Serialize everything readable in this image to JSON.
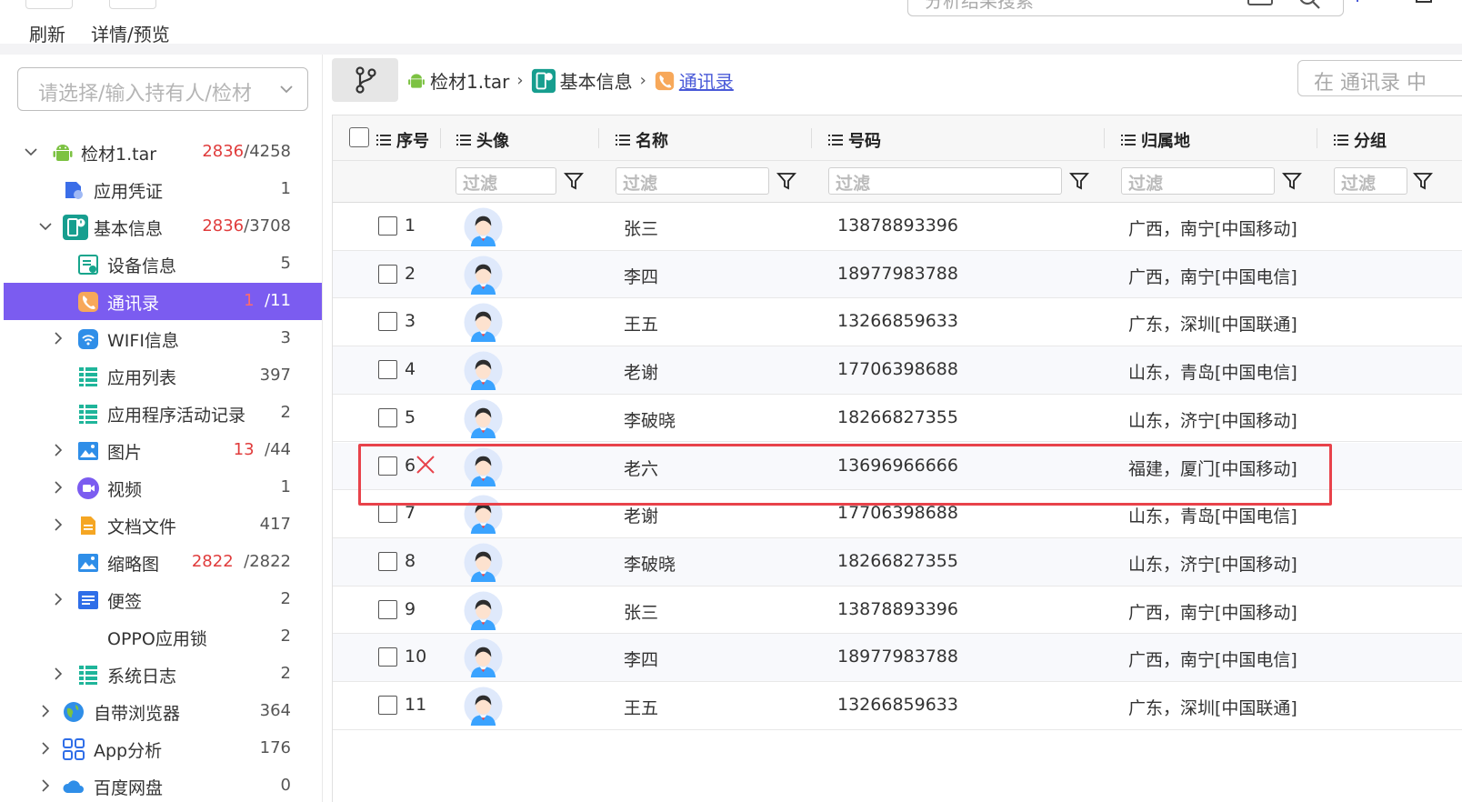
{
  "toolbar": {
    "refresh_label": "刷新",
    "detail_label": "详情/预览",
    "search_placeholder": "分析结果搜索"
  },
  "sidebar": {
    "holder_placeholder": "请选择/输入持有人/检材",
    "items": [
      {
        "label": "检材1.tar",
        "count_red": "2836",
        "count_rest": "/4258",
        "icon": "android-icon"
      },
      {
        "label": "应用凭证",
        "count_red": "",
        "count_rest": "1",
        "icon": "credential-icon"
      },
      {
        "label": "基本信息",
        "count_red": "2836",
        "count_rest": "/3708",
        "icon": "basic-info-icon"
      },
      {
        "label": "设备信息",
        "count_red": "",
        "count_rest": "5",
        "icon": "device-info-icon"
      },
      {
        "label": "通讯录",
        "count_red": "1",
        "count_rest": "/11",
        "icon": "contacts-icon"
      },
      {
        "label": "WIFI信息",
        "count_red": "",
        "count_rest": "3",
        "icon": "wifi-icon"
      },
      {
        "label": "应用列表",
        "count_red": "",
        "count_rest": "397",
        "icon": "list-icon"
      },
      {
        "label": "应用程序活动记录",
        "count_red": "",
        "count_rest": "2",
        "icon": "list-icon"
      },
      {
        "label": "图片",
        "count_red": "13",
        "count_rest": "/44",
        "icon": "image-icon"
      },
      {
        "label": "视频",
        "count_red": "",
        "count_rest": "1",
        "icon": "video-icon"
      },
      {
        "label": "文档文件",
        "count_red": "",
        "count_rest": "417",
        "icon": "document-icon"
      },
      {
        "label": "缩略图",
        "count_red": "2822",
        "count_rest": "/2822",
        "icon": "image-icon"
      },
      {
        "label": "便签",
        "count_red": "",
        "count_rest": "2",
        "icon": "note-icon"
      },
      {
        "label": "OPPO应用锁",
        "count_red": "",
        "count_rest": "2",
        "icon": ""
      },
      {
        "label": "系统日志",
        "count_red": "",
        "count_rest": "2",
        "icon": "list-icon"
      },
      {
        "label": "自带浏览器",
        "count_red": "",
        "count_rest": "364",
        "icon": "browser-icon"
      },
      {
        "label": "App分析",
        "count_red": "",
        "count_rest": "176",
        "icon": "app-grid-icon"
      },
      {
        "label": "百度网盘",
        "count_red": "",
        "count_rest": "0",
        "icon": "cloud-icon"
      }
    ]
  },
  "breadcrumb": {
    "root": "检材1.tar",
    "middle": "基本信息",
    "current": "通讯录"
  },
  "table_search_placeholder": "在 通讯录 中",
  "table": {
    "columns": [
      "序号",
      "头像",
      "名称",
      "号码",
      "归属地",
      "分组"
    ],
    "filter_placeholder": "过滤",
    "rows": [
      {
        "num": "1",
        "name": "张三",
        "phone": "13878893396",
        "location": "广西，南宁[中国移动]"
      },
      {
        "num": "2",
        "name": "李四",
        "phone": "18977983788",
        "location": "广西，南宁[中国电信]"
      },
      {
        "num": "3",
        "name": "王五",
        "phone": "13266859633",
        "location": "广东，深圳[中国联通]"
      },
      {
        "num": "4",
        "name": "老谢",
        "phone": "17706398688",
        "location": "山东，青岛[中国电信]"
      },
      {
        "num": "5",
        "name": "李破晓",
        "phone": "18266827355",
        "location": "山东，济宁[中国移动]"
      },
      {
        "num": "6",
        "name": "老六",
        "phone": "13696966666",
        "location": "福建，厦门[中国移动]"
      },
      {
        "num": "7",
        "name": "老谢",
        "phone": "17706398688",
        "location": "山东，青岛[中国电信]"
      },
      {
        "num": "8",
        "name": "李破晓",
        "phone": "18266827355",
        "location": "山东，济宁[中国移动]"
      },
      {
        "num": "9",
        "name": "张三",
        "phone": "13878893396",
        "location": "广西，南宁[中国移动]"
      },
      {
        "num": "10",
        "name": "李四",
        "phone": "18977983788",
        "location": "广西，南宁[中国电信]"
      },
      {
        "num": "11",
        "name": "王五",
        "phone": "13266859633",
        "location": "广东，深圳[中国联通]"
      }
    ]
  },
  "colors": {
    "selected_bg": "#7b5cf0",
    "accent_red": "#e03c3c",
    "highlight_border": "#e8424a",
    "link": "#4a5ad8"
  }
}
